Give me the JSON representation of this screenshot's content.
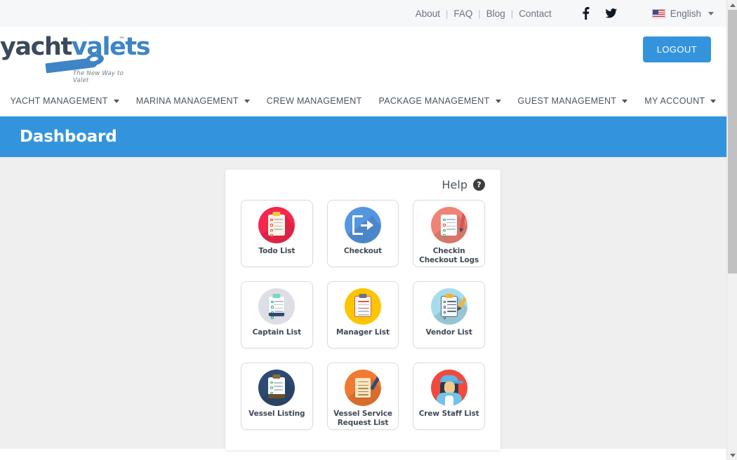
{
  "topbar": {
    "links": [
      {
        "label": "About"
      },
      {
        "label": "FAQ"
      },
      {
        "label": "Blog"
      },
      {
        "label": "Contact"
      }
    ],
    "separator": "|",
    "socials": [
      {
        "name": "facebook-icon",
        "glyph": "f"
      },
      {
        "name": "twitter-icon",
        "glyph": "t"
      }
    ],
    "language": {
      "label": "English",
      "flag": "us-flag-icon"
    }
  },
  "header": {
    "logo": {
      "text_primary": "yacht",
      "text_secondary": "valets",
      "trademark": "™",
      "tagline": "The New Way to Valet"
    },
    "logout_label": "LOGOUT"
  },
  "nav": {
    "items": [
      {
        "label": "YACHT MANAGEMENT",
        "has_caret": true
      },
      {
        "label": "MARINA MANAGEMENT",
        "has_caret": true
      },
      {
        "label": "CREW MANAGEMENT",
        "has_caret": false
      },
      {
        "label": "PACKAGE MANAGEMENT",
        "has_caret": true
      },
      {
        "label": "GUEST MANAGEMENT",
        "has_caret": true
      },
      {
        "label": "MY ACCOUNT",
        "has_caret": true
      }
    ]
  },
  "banner": {
    "title": "Dashboard"
  },
  "panel": {
    "help_label": "Help",
    "help_badge": "?",
    "cards": [
      {
        "label": "Todo List",
        "icon": "clipboard-checklist-icon",
        "circle": "#f5274e",
        "paper": "#fdf4e3",
        "accent": "#f5c342"
      },
      {
        "label": "Checkout",
        "icon": "exit-arrow-icon",
        "circle": "#5596e0",
        "paper": "#ffffff",
        "accent": "#ffffff"
      },
      {
        "label": "Checkin Checkout Logs",
        "icon": "document-pen-icon",
        "circle": "#ef8476",
        "paper": "#fbfbfb",
        "accent": "#d9534f"
      },
      {
        "label": "Captain List",
        "icon": "clipboard-check-icon",
        "circle": "#dedfe6",
        "paper": "#ffffff",
        "accent": "#2aa98a"
      },
      {
        "label": "Manager List",
        "icon": "clipboard-lines-icon",
        "circle": "#fdc500",
        "paper": "#fdfdfd",
        "accent": "#e2574c"
      },
      {
        "label": "Vendor List",
        "icon": "clipboard-pencil-icon",
        "circle": "#a8dced",
        "paper": "#f4f7f9",
        "accent": "#f5b335"
      },
      {
        "label": "Vessel Listing",
        "icon": "clipboard-dark-icon",
        "circle": "#2f4a72",
        "paper": "#fbfbfb",
        "accent": "#3cb878"
      },
      {
        "label": "Vessel Service Request List",
        "icon": "document-pen-orange-icon",
        "circle": "#f07a32",
        "paper": "#f7e7c4",
        "accent": "#2f4a7d"
      },
      {
        "label": "Crew Staff List",
        "icon": "crew-person-icon",
        "circle": "#f04a3f",
        "paper": "#ffffff",
        "accent": "#5fb8e6"
      }
    ]
  },
  "colors": {
    "brand_blue": "#3394dd",
    "banner_blue": "#3394dd",
    "topbar_bg": "#f6f7f9",
    "content_bg": "#efefef",
    "logo_blue": "#3e84c6",
    "logo_dark": "#3a4a5a"
  }
}
